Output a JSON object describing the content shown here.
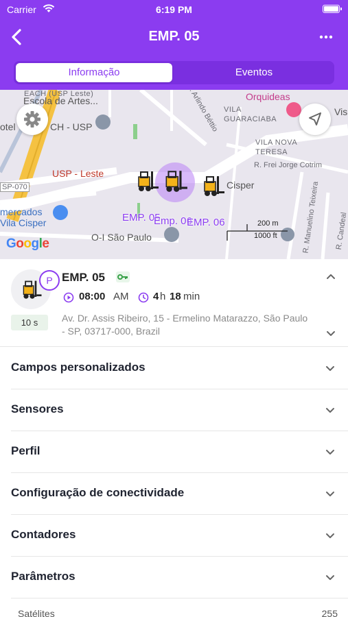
{
  "status_bar": {
    "carrier": "Carrier",
    "time": "6:19 PM"
  },
  "nav": {
    "title": "EMP. 05"
  },
  "tabs": [
    {
      "label": "Informação",
      "active": true
    },
    {
      "label": "Eventos",
      "active": false
    }
  ],
  "map": {
    "labels": {
      "each": "EACH (USP Leste)",
      "escola": "Escola de Artes...",
      "ch_usp": "CH - USP",
      "hotel": "otel",
      "orquideas": "Orquideas",
      "vila_guaraciaba": "VILA\nGUARACIABA",
      "vila_nova_teresa": "VILA NOVA\nTERESA",
      "frei_jorge": "R. Frei Jorge Cotrim",
      "usp_leste": "USP - Leste",
      "sp070": "SP-070",
      "mercados": "mercados",
      "vila_cisper": "Vila Cisper",
      "cisper": "Cisper",
      "oi_sao_paulo": "O-I São Paulo",
      "arlindo": "R. Arlindo Béttio",
      "manuelino": "R. Manuelino Teixeira",
      "candeal": "R. Candeal",
      "vis": "Vis"
    },
    "vehicle_labels": [
      "EMP. 05",
      "Emp. 06",
      "EMP. 06"
    ],
    "scale": {
      "metric": "200 m",
      "imperial": "1000 ft"
    },
    "logo": "Google"
  },
  "device": {
    "name": "EMP. 05",
    "badge": "P",
    "time_value": "08:00",
    "time_suffix": "AM",
    "duration_h": "4",
    "duration_h_unit": "h",
    "duration_min": "18",
    "duration_min_unit": "min",
    "interval": "10 s",
    "address": "Av. Dr. Assis Ribeiro, 15 - Ermelino Matarazzo, São Paulo - SP, 03717-000, Brazil"
  },
  "sections": [
    {
      "label": "Campos personalizados"
    },
    {
      "label": "Sensores"
    },
    {
      "label": "Perfil"
    },
    {
      "label": "Configuração de conectividade"
    },
    {
      "label": "Contadores"
    },
    {
      "label": "Parâmetros"
    }
  ],
  "partial_row": {
    "label": "Satélites",
    "value": "255"
  },
  "colors": {
    "accent": "#8b3cf0",
    "accent_dark": "#7a2fe0",
    "text": "#1f2330",
    "muted": "#8a8a8a"
  }
}
